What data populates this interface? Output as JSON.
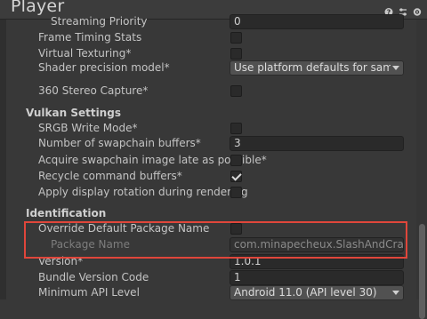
{
  "header": {
    "title": "Player",
    "icons": [
      "help-icon",
      "presets-icon",
      "settings-icon"
    ]
  },
  "rows": {
    "streaming_priority": {
      "label": "Streaming Priority",
      "value": "0"
    },
    "frame_timing": {
      "label": "Frame Timing Stats",
      "checked": false
    },
    "virtual_texturing": {
      "label": "Virtual Texturing*",
      "checked": false
    },
    "shader_precision": {
      "label": "Shader precision model*",
      "value": "Use platform defaults for sampler pre"
    },
    "stereo_capture": {
      "label": "360 Stereo Capture*",
      "checked": false
    },
    "vulkan_section": "Vulkan Settings",
    "srgb_write": {
      "label": "SRGB Write Mode*",
      "checked": false
    },
    "swapchain_buffers": {
      "label": "Number of swapchain buffers*",
      "value": "3"
    },
    "acquire_swapchain": {
      "label": "Acquire swapchain image late as possible*",
      "checked": false
    },
    "recycle_buffers": {
      "label": "Recycle command buffers*",
      "checked": true
    },
    "display_rotation": {
      "label": "Apply display rotation during rendering",
      "checked": false
    },
    "identification_section": "Identification",
    "override_package": {
      "label": "Override Default Package Name",
      "checked": false
    },
    "package_name": {
      "label": "Package Name",
      "value": "com.minapecheux.SlashAndCrack"
    },
    "version": {
      "label": "Version*",
      "value": "1.0.1"
    },
    "bundle_version": {
      "label": "Bundle Version Code",
      "value": "1"
    },
    "min_api": {
      "label": "Minimum API Level",
      "value": "Android 11.0 (API level 30)"
    }
  },
  "colors": {
    "highlight": "#e0463b",
    "background": "#383838"
  }
}
